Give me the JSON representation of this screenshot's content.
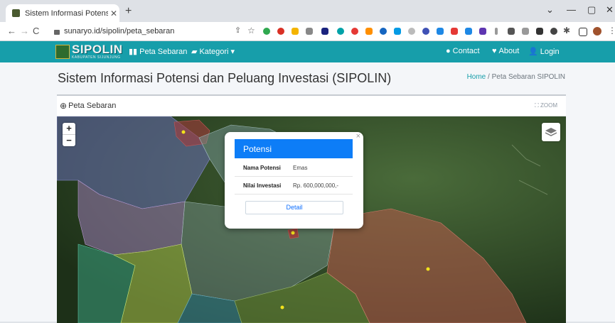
{
  "browser": {
    "tab_title": "Sistem Informasi Potensi dan Pe",
    "tab_close": "✕",
    "new_tab": "+",
    "url": "sunaryo.id/sipolin/peta_sebaran",
    "window_controls": [
      "⌄",
      "—",
      "▢",
      "✕"
    ]
  },
  "navbar": {
    "logo_text": "SIPOLIN",
    "logo_sub": "KABUPATEN SIJUNJUNG",
    "menu": [
      {
        "label": "Peta Sebaran",
        "icon": "map-icon"
      },
      {
        "label": "Kategori ▾",
        "icon": "folder-icon"
      }
    ],
    "right_menu": [
      {
        "label": "Contact",
        "icon": "chat-icon"
      },
      {
        "label": "About",
        "icon": "heart-icon"
      },
      {
        "label": "Login",
        "icon": "user-icon"
      }
    ]
  },
  "page": {
    "title": "Sistem Informasi Potensi dan Peluang Investasi (SIPOLIN)",
    "breadcrumb_home": "Home",
    "breadcrumb_sep": "/",
    "breadcrumb_current": "Peta Sebaran SIPOLIN"
  },
  "card": {
    "title": "Peta Sebaran",
    "zoom_label": "ZOOM"
  },
  "map": {
    "zoom_in": "+",
    "zoom_out": "−",
    "popup": {
      "header": "Potensi",
      "close": "×",
      "rows": [
        {
          "key": "Nama Potensi",
          "value": "Emas"
        },
        {
          "key": "Nilai Investasi",
          "value": "Rp. 600,000,000,-"
        }
      ],
      "button": "Detail"
    }
  },
  "colors": {
    "navbar": "#179eaa",
    "popup_header": "#0d7df7",
    "link": "#179eaa"
  }
}
